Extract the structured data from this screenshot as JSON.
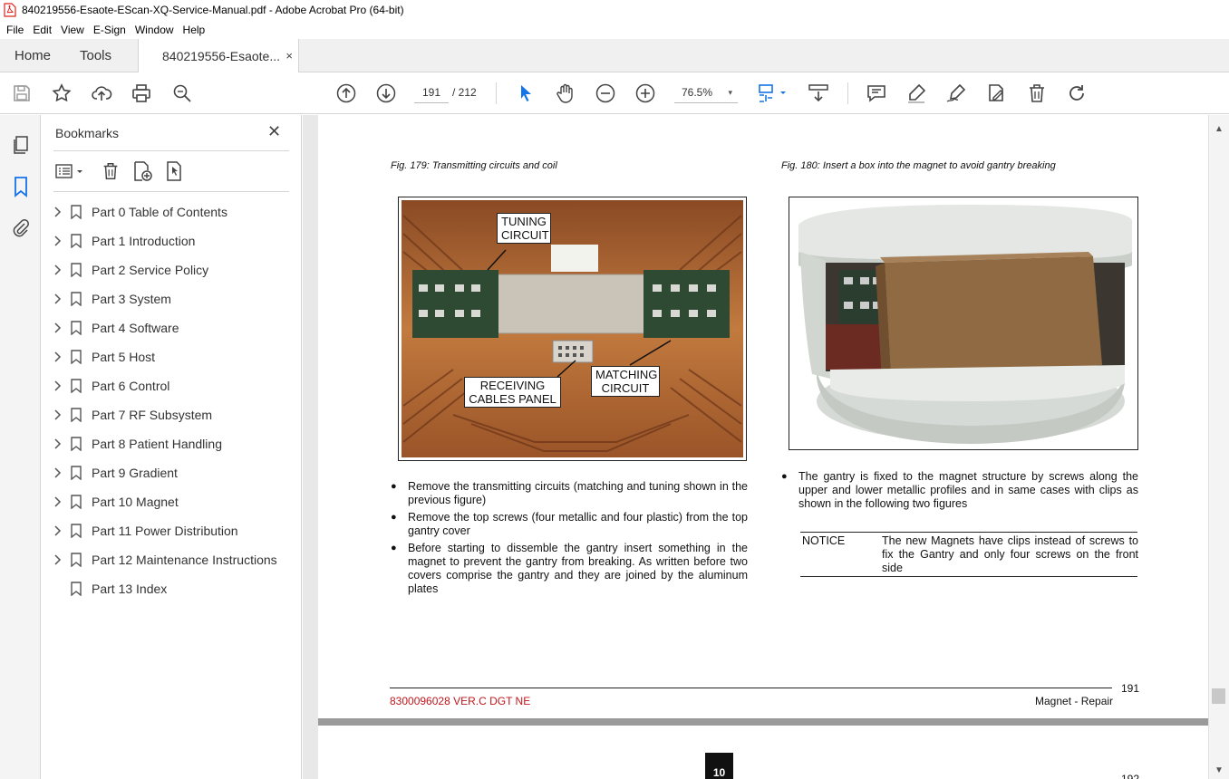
{
  "window": {
    "title": "840219556-Esaote-EScan-XQ-Service-Manual.pdf - Adobe Acrobat Pro (64-bit)"
  },
  "menu": [
    "File",
    "Edit",
    "View",
    "E-Sign",
    "Window",
    "Help"
  ],
  "tabs": {
    "home": "Home",
    "tools": "Tools",
    "document": "840219556-Esaote...",
    "close": "×"
  },
  "toolbar": {
    "current_page": "191",
    "total_pages": "/ 212",
    "zoom": "76.5%",
    "zoom_arrow": "▾"
  },
  "bookmarks": {
    "title": "Bookmarks",
    "close": "✕",
    "items": [
      {
        "label": "Part 0 Table of Contents",
        "expandable": true
      },
      {
        "label": "Part 1 Introduction",
        "expandable": true
      },
      {
        "label": "Part 2 Service Policy",
        "expandable": true
      },
      {
        "label": "Part 3 System",
        "expandable": true
      },
      {
        "label": "Part 4 Software",
        "expandable": true
      },
      {
        "label": "Part 5 Host",
        "expandable": true
      },
      {
        "label": "Part 6 Control",
        "expandable": true
      },
      {
        "label": "Part 7 RF Subsystem",
        "expandable": true
      },
      {
        "label": "Part 8 Patient Handling",
        "expandable": true
      },
      {
        "label": "Part 9 Gradient",
        "expandable": true
      },
      {
        "label": "Part 10 Magnet",
        "expandable": true
      },
      {
        "label": "Part 11 Power Distribution",
        "expandable": true
      },
      {
        "label": "Part 12 Maintenance Instructions",
        "expandable": true
      },
      {
        "label": "Part 13 Index",
        "expandable": false
      }
    ]
  },
  "page": {
    "fig179_caption": "Fig. 179: Transmitting circuits and coil",
    "fig180_caption": "Fig. 180: Insert a box into the magnet to avoid gantry breaking",
    "callouts": {
      "tuning": "TUNING\nCIRCUIT",
      "receiving": "RECEIVING\nCABLES PANEL",
      "matching": "MATCHING\nCIRCUIT"
    },
    "left_bullets": [
      "Remove the transmitting circuits (matching and tuning shown in the previous figure)",
      "Remove the top screws (four metallic and four plastic) from the top gantry cover",
      "Before starting to dissemble the gantry insert something in the magnet to prevent the gantry from breaking. As written before two covers comprise the gantry and they are joined by the aluminum plates"
    ],
    "right_bullets": [
      "The gantry is fixed to the magnet structure by screws along the upper and lower metallic profiles and in same cases with clips as shown in the following two figures"
    ],
    "notice_label": "NOTICE",
    "notice_text": "The new Magnets have clips instead of screws to fix the Gantry and only four screws on the front side",
    "footer_page": "191",
    "footer_doc_code": "8300096028 VER.C DGT NE",
    "footer_section": "Magnet - Repair",
    "next_page_badge": "10",
    "next_page_num": "192"
  },
  "colors": {
    "accent_blue": "#1473e6",
    "doc_code_red": "#c0161c",
    "pdf_icon_red": "#d9241c"
  }
}
